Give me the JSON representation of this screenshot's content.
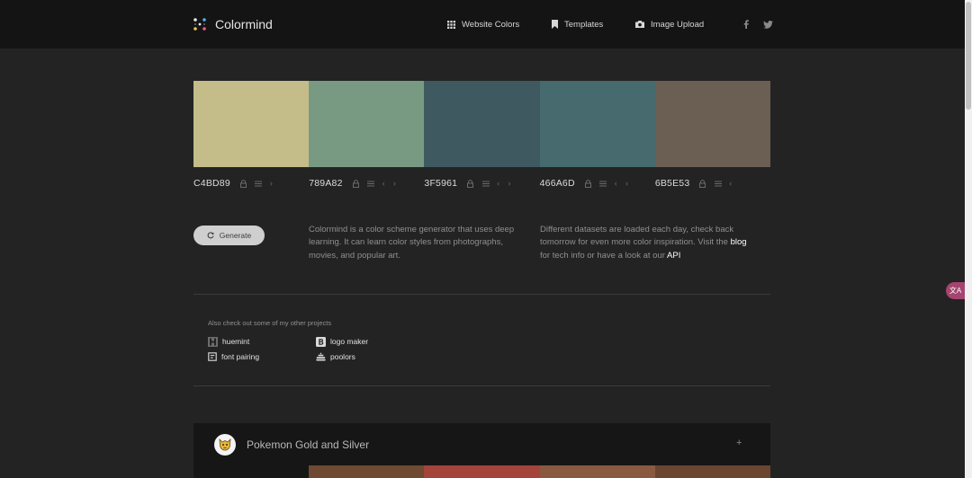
{
  "brand": {
    "name": "Colormind"
  },
  "nav": {
    "website_colors": "Website Colors",
    "templates": "Templates",
    "image_upload": "Image Upload"
  },
  "palette": [
    {
      "hex": "C4BD89",
      "color": "#C4BD89"
    },
    {
      "hex": "789A82",
      "color": "#789A82"
    },
    {
      "hex": "3F5961",
      "color": "#3F5961"
    },
    {
      "hex": "466A6D",
      "color": "#466A6D"
    },
    {
      "hex": "6B5E53",
      "color": "#6B5E53"
    }
  ],
  "controls": {
    "left_arrow": "‹",
    "right_arrow": "›"
  },
  "generate": {
    "label": "Generate"
  },
  "description": {
    "left": "Colormind is a color scheme generator that uses deep learning. It can learn color styles from photographs, movies, and popular art.",
    "right_before_blog": "Different datasets are loaded each day, check back tomorrow for even more color inspiration. Visit the ",
    "blog": "blog",
    "right_middle": " for tech info or have a look at our ",
    "api": "API"
  },
  "projects": {
    "heading": "Also check out some of my other projects",
    "huemint": "huemint",
    "logo_maker": "logo maker",
    "font_pairing": "font pairing",
    "poolors": "poolors"
  },
  "card": {
    "title": "Pokemon Gold and Silver",
    "plus": "+",
    "strip": [
      "#161616",
      "#6e4a32",
      "#a4443a",
      "#8a5a40",
      "#6b4530"
    ]
  },
  "side_widget": {
    "label": "文A"
  },
  "colors": {
    "background": "#232323",
    "navbar": "#141414",
    "accent_widget": "#A5456F"
  }
}
